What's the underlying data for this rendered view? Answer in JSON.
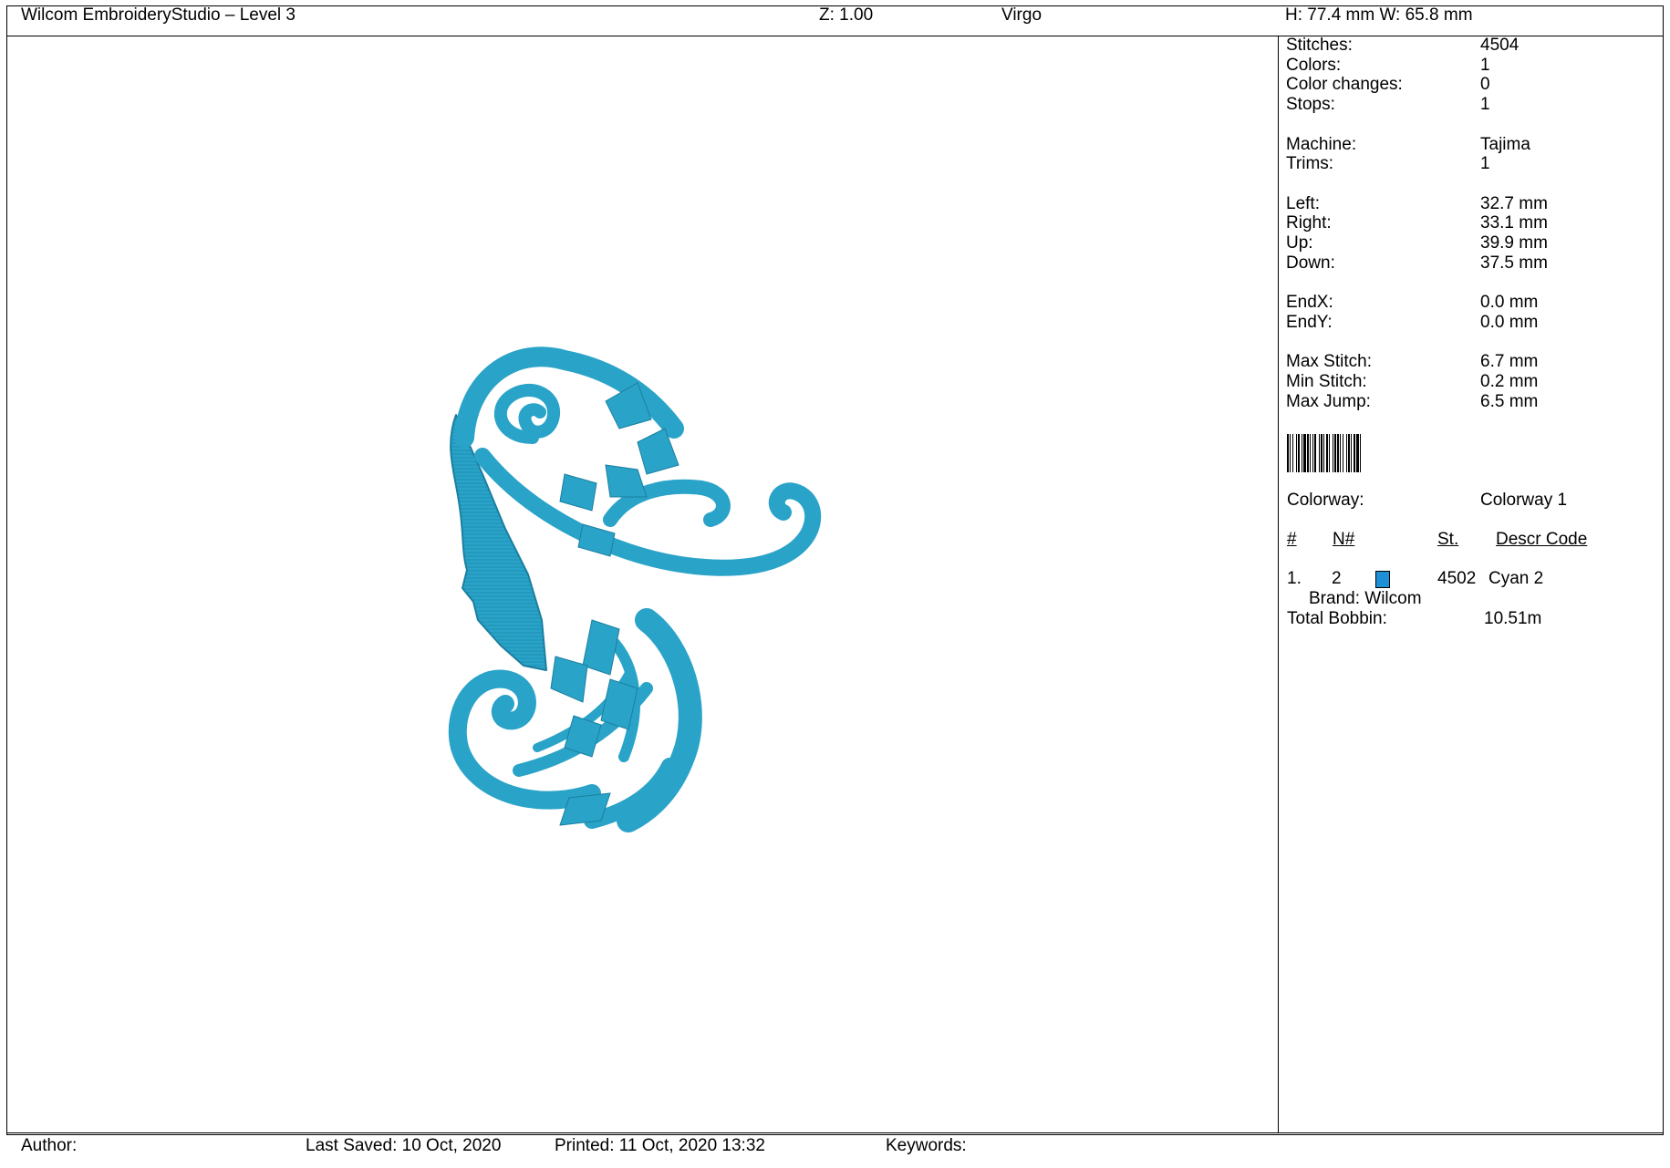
{
  "header": {
    "app_title": "Wilcom EmbroideryStudio – Level 3",
    "zoom": "Z: 1.00",
    "design_name": "Virgo",
    "dimensions": "H: 77.4 mm   W: 65.8 mm"
  },
  "stats": [
    {
      "label": "Stitches:",
      "value": "4504"
    },
    {
      "label": "Colors:",
      "value": "1"
    },
    {
      "label": "Color changes:",
      "value": "0"
    },
    {
      "label": "Stops:",
      "value": "1"
    },
    {
      "label": "Machine:",
      "value": "Tajima"
    },
    {
      "label": "Trims:",
      "value": "1"
    },
    {
      "label": "Left:",
      "value": "32.7 mm"
    },
    {
      "label": "Right:",
      "value": "33.1 mm"
    },
    {
      "label": "Up:",
      "value": "39.9 mm"
    },
    {
      "label": "Down:",
      "value": "37.5 mm"
    },
    {
      "label": "EndX:",
      "value": "0.0 mm"
    },
    {
      "label": "EndY:",
      "value": "0.0 mm"
    },
    {
      "label": "Max Stitch:",
      "value": "6.7 mm"
    },
    {
      "label": "Min Stitch:",
      "value": "0.2 mm"
    },
    {
      "label": "Max Jump:",
      "value": "6.5 mm"
    }
  ],
  "colorway": {
    "label": "Colorway:",
    "value": "Colorway 1"
  },
  "color_table": {
    "headers": {
      "num": "#",
      "n_num": "N#",
      "stitches": "St.",
      "descr_code": "Descr  Code"
    },
    "rows": [
      {
        "index": "1.",
        "needle": "2",
        "swatch_color": "#1e8fd6",
        "stitches": "4502",
        "descr": "Cyan 2",
        "brand": "Brand: Wilcom"
      }
    ],
    "total_bobbin_label": "Total Bobbin:",
    "total_bobbin_value": "10.51m"
  },
  "footer": {
    "author": "Author:",
    "last_saved": "Last Saved: 10 Oct, 2020",
    "printed": "Printed: 11 Oct, 2020 13:32",
    "keywords": "Keywords:"
  },
  "colors": {
    "thread": "#2aa3c8",
    "thread_dark": "#1b7f9f",
    "border": "#000000"
  }
}
